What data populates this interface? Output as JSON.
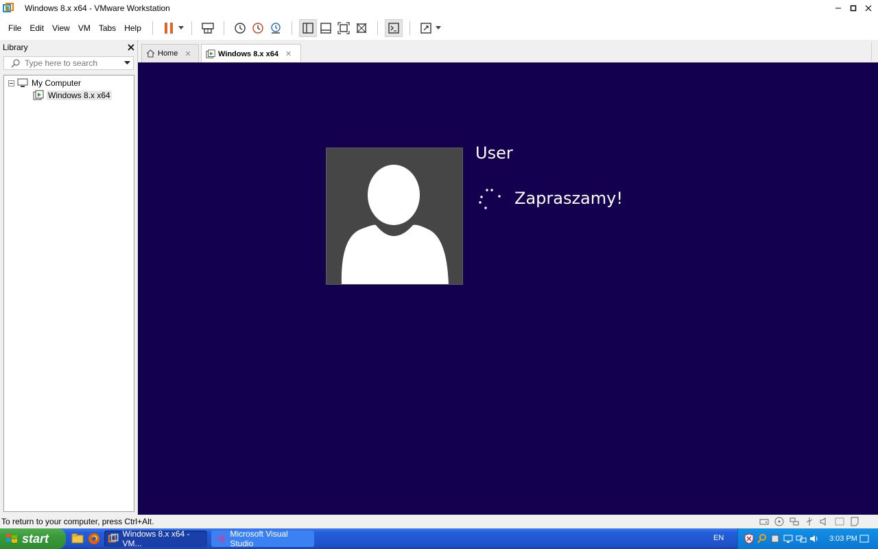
{
  "window": {
    "title": "Windows 8.x x64 - VMware Workstation"
  },
  "menu": [
    "File",
    "Edit",
    "View",
    "VM",
    "Tabs",
    "Help"
  ],
  "toolbar": {
    "icons": [
      "pause-icon",
      "dropdown-arrow-icon",
      "send-ctrl-alt-del-icon",
      "snapshot-icon",
      "revert-snapshot-icon",
      "snapshot-manager-icon",
      "show-library-icon",
      "thumbnail-bar-icon",
      "full-screen-icon",
      "unity-icon",
      "console-view-icon",
      "stretch-guest-icon"
    ]
  },
  "library": {
    "title": "Library",
    "search_placeholder": "Type here to search",
    "tree": {
      "root": "My Computer",
      "child": "Windows 8.x x64"
    }
  },
  "tabs": [
    {
      "label": "Home"
    },
    {
      "label": "Windows 8.x x64"
    }
  ],
  "vm": {
    "username": "User",
    "welcome": "Zapraszamy!",
    "background_color": "#13004f"
  },
  "statusbar": {
    "message": "To return to your computer, press Ctrl+Alt."
  },
  "taskbar": {
    "start_label": "start",
    "tasks": [
      {
        "label": "Windows 8.x x64 - VM..."
      },
      {
        "label": "Microsoft Visual Studio"
      }
    ],
    "language": "EN",
    "clock": "3:03 PM"
  }
}
